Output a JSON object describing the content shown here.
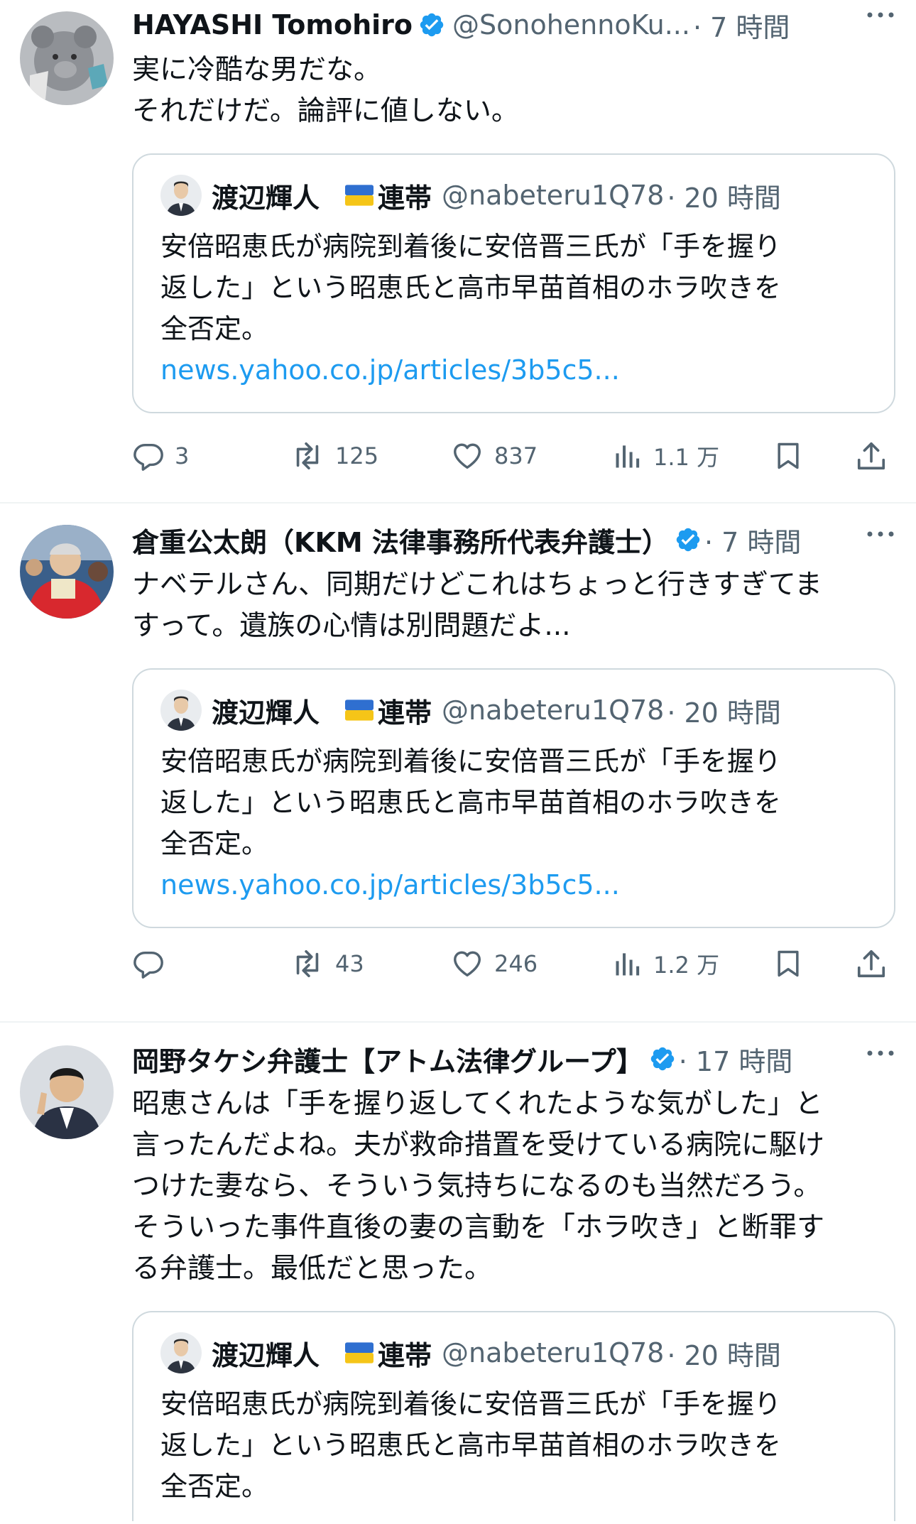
{
  "tweets": [
    {
      "name": "HAYASHI Tomohiro",
      "handle": "@SonohennoKu...",
      "time": "· 7 時間",
      "lines": [
        "実に冷酷な男だな。",
        "それだけだ。論評に値しない。"
      ],
      "quote": {
        "name": "渡辺輝人",
        "tag": "連帯",
        "handle": "@nabeteru1Q78",
        "time": "· 20 時間",
        "lines": [
          "安倍昭恵氏が病院到着後に安倍晋三氏が「手を握り",
          "返した」という昭恵氏と高市早苗首相のホラ吹きを",
          "全否定。"
        ],
        "link": "news.yahoo.co.jp/articles/3b5c5..."
      },
      "stats": {
        "replies": "3",
        "reposts": "125",
        "likes": "837",
        "views": "1.1 万"
      }
    },
    {
      "name": "倉重公太朗（KKM 法律事務所代表弁護士）",
      "handle": "",
      "time": "· 7 時間",
      "lines": [
        "ナベテルさん、同期だけどこれはちょっと行きすぎてま",
        "すって。遺族の心情は別問題だよ..."
      ],
      "quote": {
        "name": "渡辺輝人",
        "tag": "連帯",
        "handle": "@nabeteru1Q78",
        "time": "· 20 時間",
        "lines": [
          "安倍昭恵氏が病院到着後に安倍晋三氏が「手を握り",
          "返した」という昭恵氏と高市早苗首相のホラ吹きを",
          "全否定。"
        ],
        "link": "news.yahoo.co.jp/articles/3b5c5..."
      },
      "stats": {
        "replies": "",
        "reposts": "43",
        "likes": "246",
        "views": "1.2 万"
      }
    },
    {
      "name": "岡野タケシ弁護士【アトム法律グループ】",
      "handle": "",
      "time": "· 17 時間",
      "lines": [
        "昭恵さんは「手を握り返してくれたような気がした」と",
        "言ったんだよね。夫が救命措置を受けている病院に駆け",
        "つけた妻なら、そういう気持ちになるのも当然だろう。",
        "そういった事件直後の妻の言動を「ホラ吹き」と断罪す",
        "る弁護士。最低だと思った。"
      ],
      "quote": {
        "name": "渡辺輝人",
        "tag": "連帯",
        "handle": "@nabeteru1Q78",
        "time": "· 20 時間",
        "lines": [
          "安倍昭恵氏が病院到着後に安倍晋三氏が「手を握り",
          "返した」という昭恵氏と高市早苗首相のホラ吹きを",
          "全否定。"
        ],
        "link": ""
      }
    }
  ],
  "colors": {
    "text": "#0f1419",
    "secondary": "#536471",
    "verified": "#1d9bf0",
    "link": "#1d9bf0",
    "border": "#cfd9de"
  },
  "icons": [
    "verified-badge-icon",
    "more-icon",
    "reply-icon",
    "repost-icon",
    "like-icon",
    "views-icon",
    "bookmark-icon",
    "share-icon",
    "ukraine-flag-icon"
  ]
}
